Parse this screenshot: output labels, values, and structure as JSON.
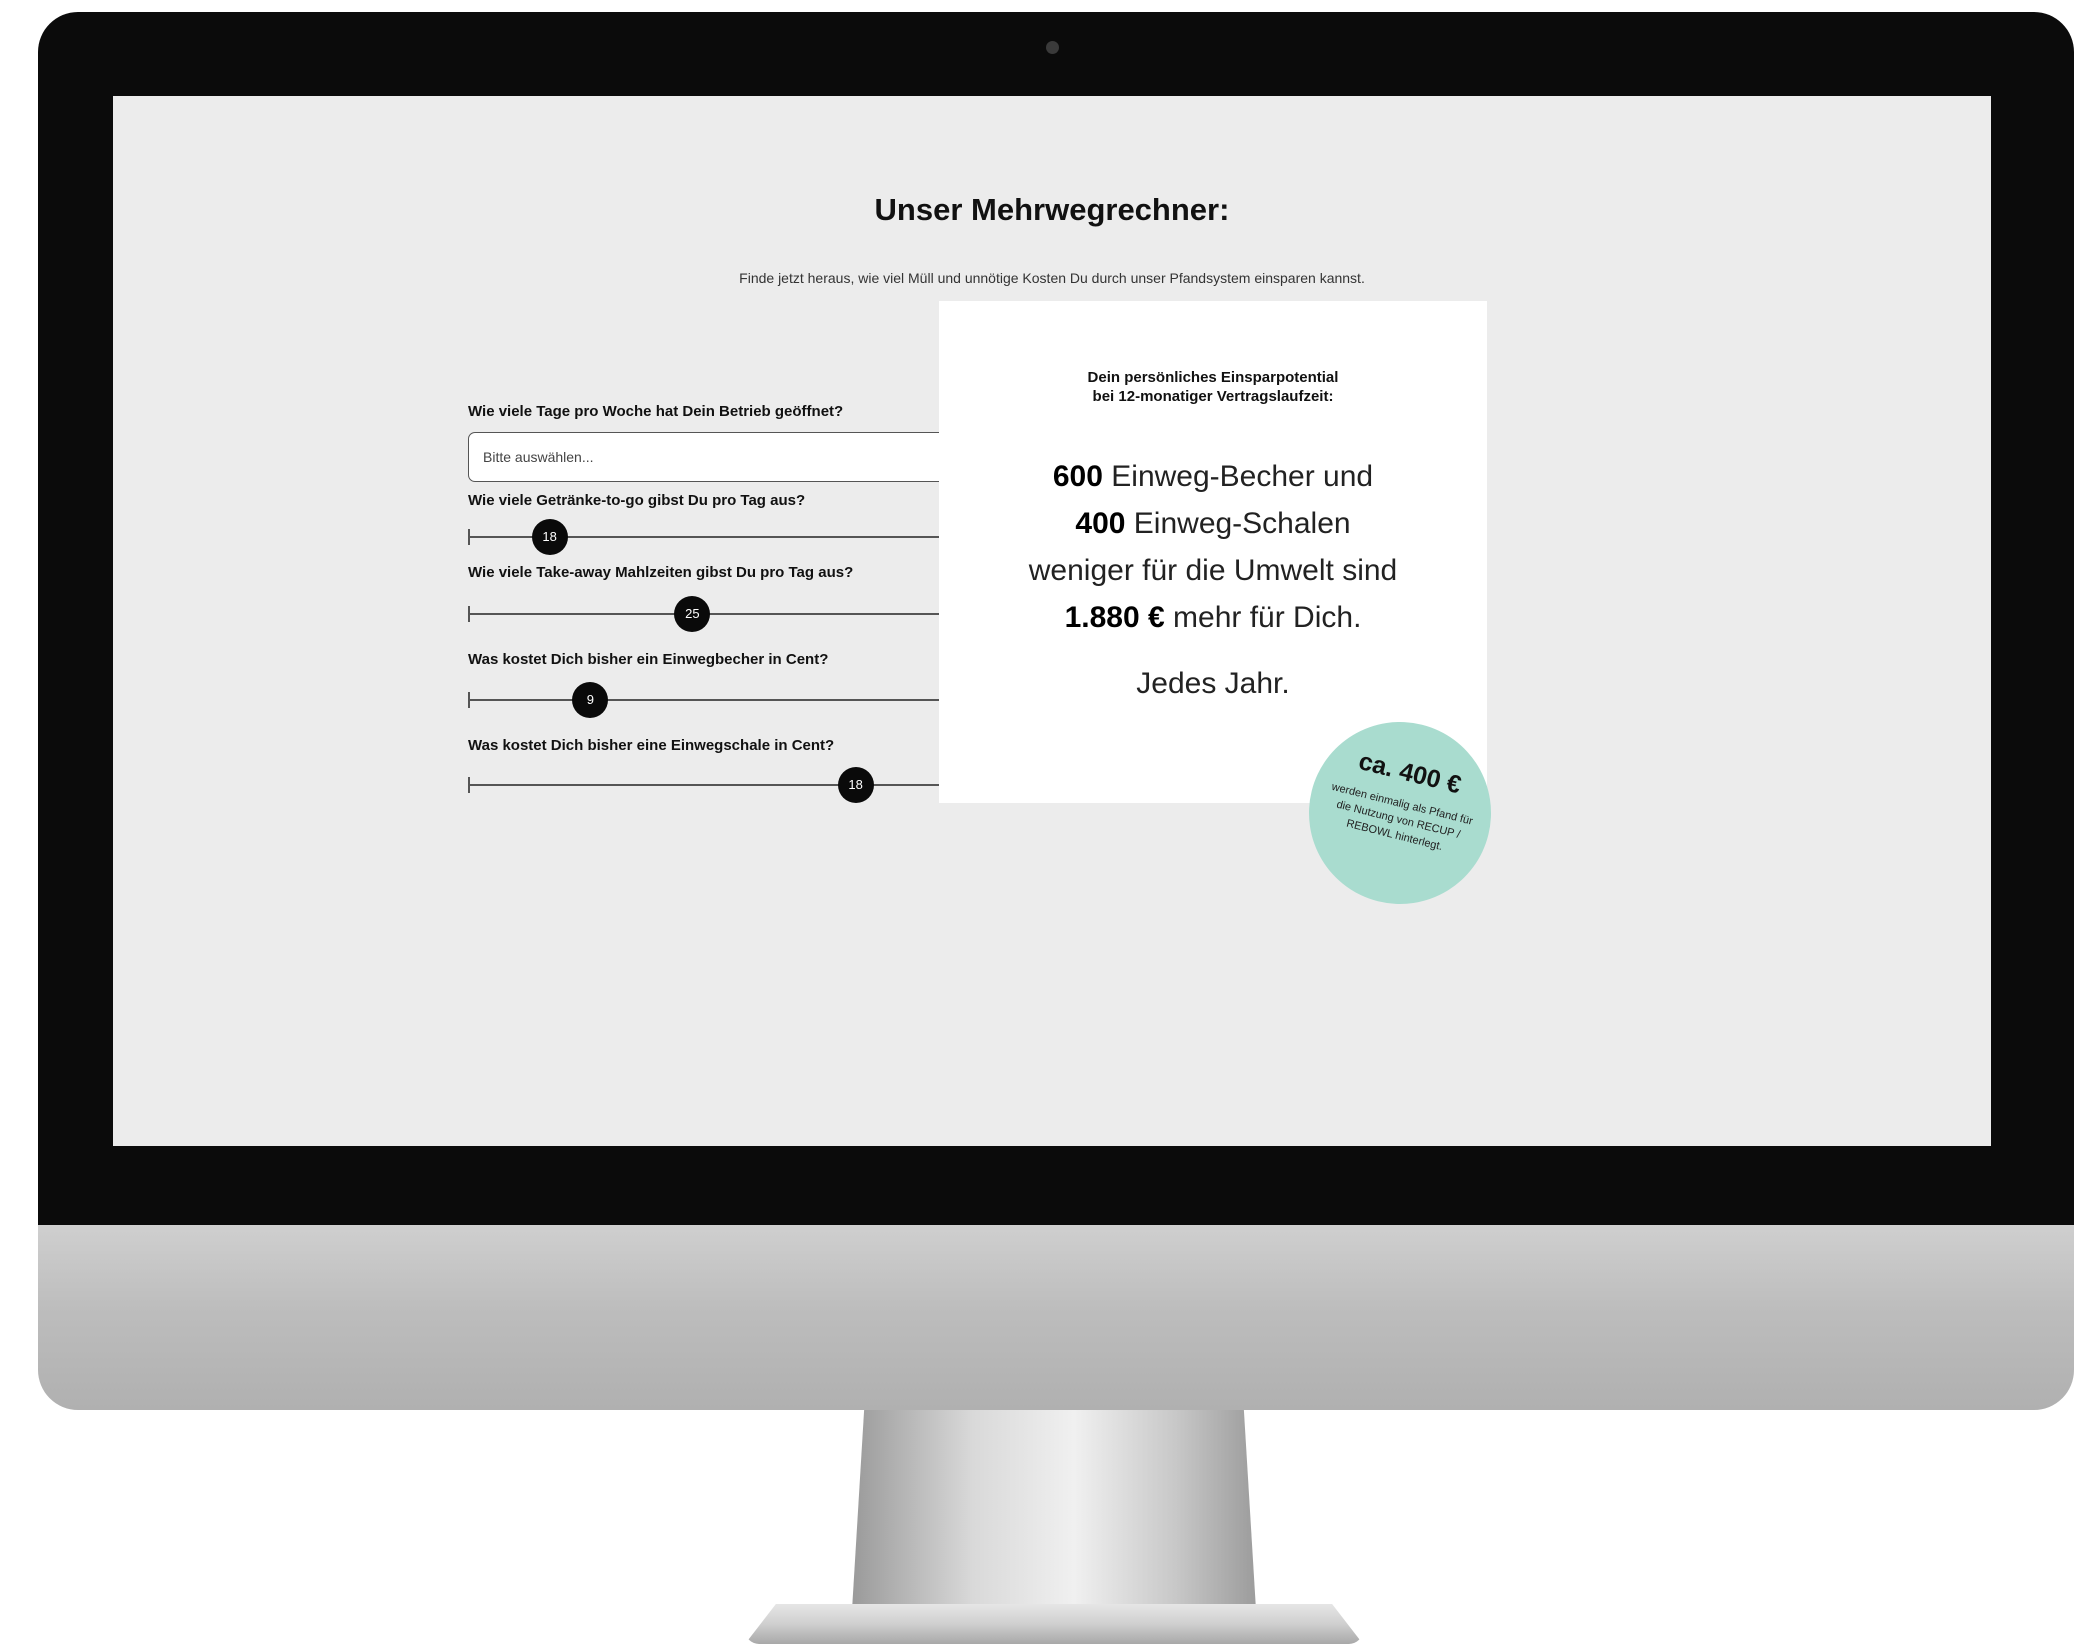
{
  "page": {
    "title": "Unser Mehrwegrechner:",
    "subtitle": "Finde jetzt heraus, wie viel Müll und unnötige Kosten Du durch unser Pfandsystem einsparen kannst."
  },
  "form": {
    "days_question": "Wie viele Tage pro Woche hat Dein Betrieb geöffnet?",
    "days_placeholder": "Bitte auswählen...",
    "sliders": [
      {
        "question": "Wie viele Getränke-to-go gibst Du pro Tag aus?",
        "value": "18",
        "fraction": 0.16
      },
      {
        "question": "Wie viele Take-away Mahlzeiten gibst Du pro Tag aus?",
        "value": "25",
        "fraction": 0.44
      },
      {
        "question": "Was kostet Dich bisher ein Einwegbecher in Cent?",
        "value": "9",
        "fraction": 0.24
      },
      {
        "question": "Was kostet Dich bisher eine Einwegschale in Cent?",
        "value": "18",
        "fraction": 0.76
      }
    ]
  },
  "result": {
    "intro_line1": "Dein persönliches Einsparpotential",
    "intro_line2": "bei 12-monatiger Vertragslaufzeit:",
    "cups_value": "600",
    "cups_text": " Einweg-Becher und",
    "bowls_value": "400",
    "bowls_text": " Einweg-Schalen",
    "environment_text": "weniger für die Umwelt sind",
    "money_value": "1.880 €",
    "money_text": " mehr für Dich.",
    "footer": "Jedes Jahr."
  },
  "badge": {
    "amount": "ca. 400 €",
    "text": "werden einmalig als Pfand für die Nutzung von RECUP / REBOWL hinterlegt."
  },
  "colors": {
    "screen_bg": "#ececec",
    "badge_bg": "#a9dccf",
    "thumb": "#0a0a0a"
  }
}
